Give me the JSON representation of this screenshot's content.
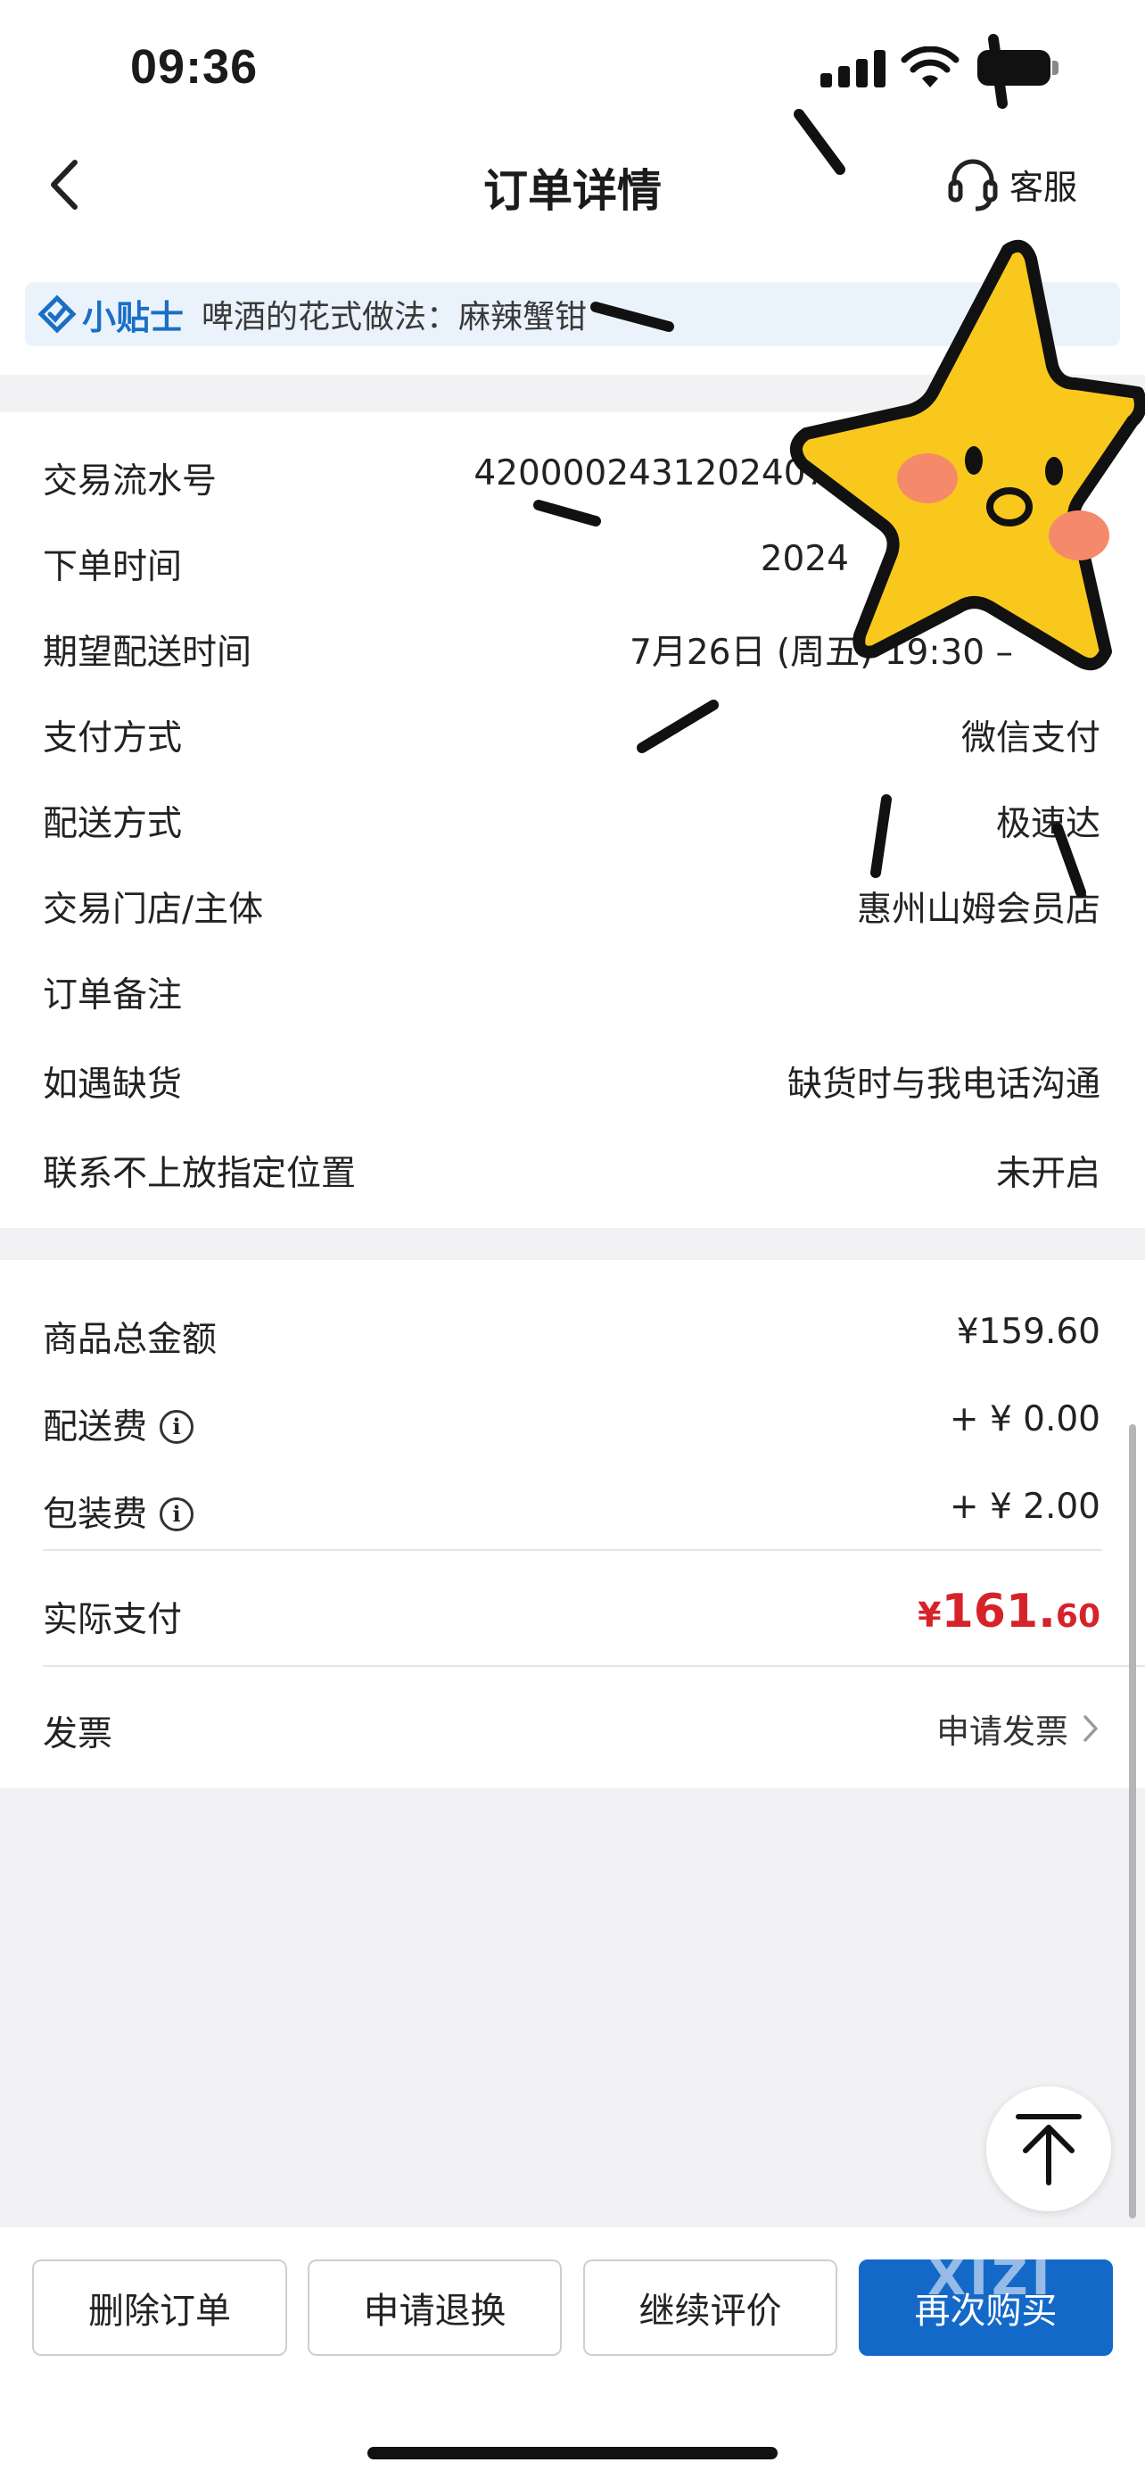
{
  "status_bar": {
    "time": "09:36"
  },
  "nav": {
    "title": "订单详情",
    "customer_service": "客服"
  },
  "tip": {
    "badge": "小贴士",
    "text": "啤酒的花式做法：麻辣蟹钳"
  },
  "order_info": [
    {
      "label": "交易流水号",
      "value": "420000243120240726"
    },
    {
      "label": "下单时间",
      "value": "2024"
    },
    {
      "label": "期望配送时间",
      "value": "7月26日 (周五) 19:30 –"
    },
    {
      "label": "支付方式",
      "value": "微信支付"
    },
    {
      "label": "配送方式",
      "value": "极速达"
    },
    {
      "label": "交易门店/主体",
      "value": "惠州山姆会员店"
    },
    {
      "label": "订单备注",
      "value": ""
    },
    {
      "label": "如遇缺货",
      "value": "缺货时与我电话沟通"
    },
    {
      "label": "联系不上放指定位置",
      "value": "未开启"
    }
  ],
  "amounts": {
    "goods_total": {
      "label": "商品总金额",
      "value": "¥159.60"
    },
    "delivery_fee": {
      "label": "配送费",
      "value": "+ ¥ 0.00"
    },
    "packing_fee": {
      "label": "包装费",
      "value": "+ ¥ 2.00"
    },
    "actual_paid": {
      "label": "实际支付",
      "symbol": "¥",
      "integer": "161.",
      "decimal": "60"
    },
    "invoice": {
      "label": "发票",
      "link": "申请发票"
    }
  },
  "actions": {
    "delete": "删除订单",
    "refund": "申请退换",
    "review": "继续评价",
    "rebuy": "再次购买"
  },
  "watermark": "XIZI",
  "colors": {
    "primary": "#1469c8",
    "price_red": "#d6232a",
    "tip_bg": "#eaf3fc",
    "sticker_yellow": "#f9c81c"
  }
}
